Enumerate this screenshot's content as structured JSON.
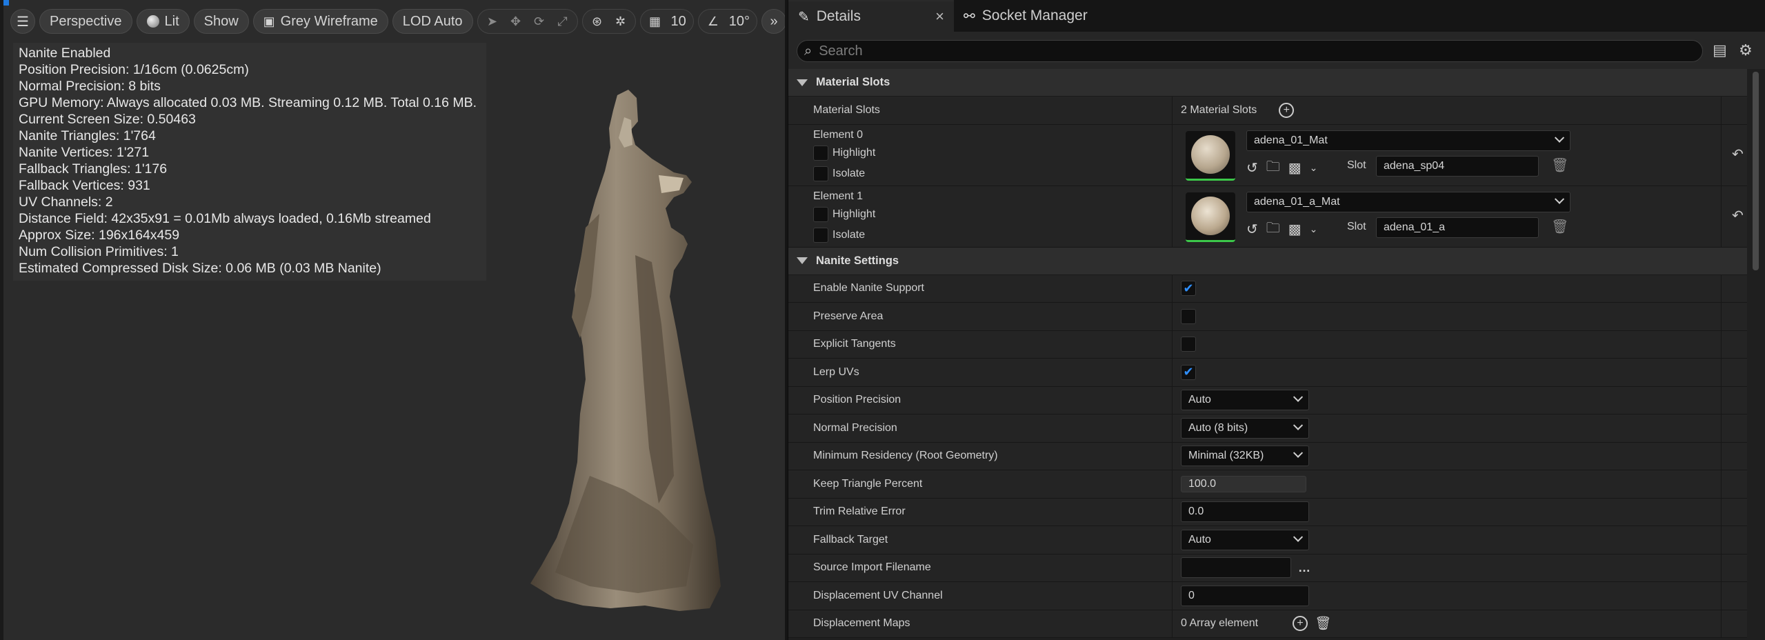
{
  "viewport": {
    "toolbar": {
      "view_mode": "Perspective",
      "lighting": "Lit",
      "show": "Show",
      "wireframe": "Grey Wireframe",
      "lod": "LOD Auto",
      "grid_snap": "10",
      "rotation_snap": "10°"
    },
    "stats": [
      "Nanite Enabled",
      "Position Precision: 1/16cm (0.0625cm)",
      "Normal Precision: 8 bits",
      "GPU Memory: Always allocated 0.03 MB. Streaming 0.12 MB. Total 0.16 MB.",
      "Current Screen Size:  0.50463",
      "Nanite Triangles:  1'764",
      "Nanite Vertices:  1'271",
      "Fallback Triangles:  1'176",
      "Fallback Vertices:  931",
      "UV Channels:  2",
      "Distance Field:  42x35x91 = 0.01Mb always loaded, 0.16Mb streamed",
      "Approx Size: 196x164x459",
      "Num Collision Primitives:  1",
      "Estimated Compressed Disk Size: 0.06 MB (0.03 MB Nanite)"
    ]
  },
  "details": {
    "tabs": [
      {
        "label": "Details"
      },
      {
        "label": "Socket Manager"
      }
    ],
    "search_placeholder": "Search",
    "material_slots": {
      "header": "Material Slots",
      "label": "Material Slots",
      "value": "2 Material Slots",
      "elements": [
        {
          "name": "Element 0",
          "highlight": "Highlight",
          "isolate": "Isolate",
          "material": "adena_01_Mat",
          "slot_label": "Slot",
          "slot_name": "adena_sp04"
        },
        {
          "name": "Element 1",
          "highlight": "Highlight",
          "isolate": "Isolate",
          "material": "adena_01_a_Mat",
          "slot_label": "Slot",
          "slot_name": "adena_01_a"
        }
      ]
    },
    "nanite": {
      "header": "Nanite Settings",
      "enable_nanite": {
        "label": "Enable Nanite Support",
        "checked": true
      },
      "preserve_area": {
        "label": "Preserve Area",
        "checked": false
      },
      "explicit_tangents": {
        "label": "Explicit Tangents",
        "checked": false
      },
      "lerp_uvs": {
        "label": "Lerp UVs",
        "checked": true
      },
      "position_precision": {
        "label": "Position Precision",
        "value": "Auto"
      },
      "normal_precision": {
        "label": "Normal Precision",
        "value": "Auto (8 bits)"
      },
      "min_residency": {
        "label": "Minimum Residency (Root Geometry)",
        "value": "Minimal (32KB)"
      },
      "keep_triangle": {
        "label": "Keep Triangle Percent",
        "value": "100.0"
      },
      "trim_error": {
        "label": "Trim Relative Error",
        "value": "0.0"
      },
      "fallback_target": {
        "label": "Fallback Target",
        "value": "Auto"
      },
      "source_import": {
        "label": "Source Import Filename",
        "value": ""
      },
      "displacement_uv": {
        "label": "Displacement UV Channel",
        "value": "0"
      },
      "displacement_maps": {
        "label": "Displacement Maps",
        "value": "0 Array element"
      }
    }
  },
  "colors": {
    "accent": "#2f8fff",
    "thumb_border": "#3cc84a",
    "corner": "#1f7ae0"
  }
}
